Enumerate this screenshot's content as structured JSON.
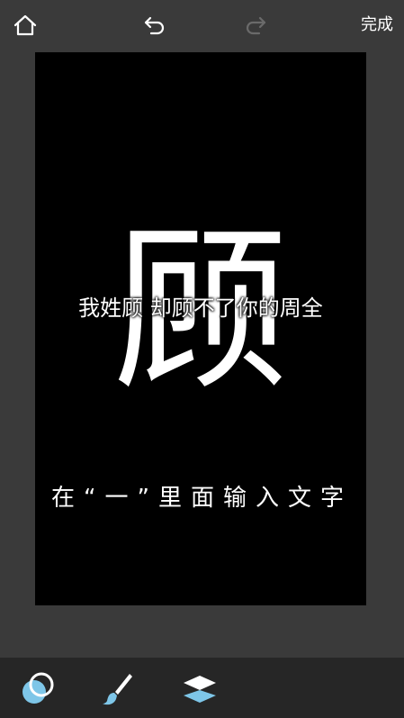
{
  "topbar": {
    "home_icon": "home-icon",
    "undo_icon": "undo-icon",
    "redo_icon": "redo-icon",
    "redo_enabled": false,
    "done_label": "完成"
  },
  "canvas": {
    "big_char": "顾",
    "caption": "我姓顾 却顾不了你的周全",
    "hint": "在“一”里面输入文字"
  },
  "bottombar": {
    "tools": [
      "circle-tool-icon",
      "brush-icon",
      "layers-icon"
    ]
  },
  "colors": {
    "background": "#3a3a3a",
    "canvas": "#000000",
    "bottombar": "#262626",
    "accent": "#7ec6e8"
  }
}
